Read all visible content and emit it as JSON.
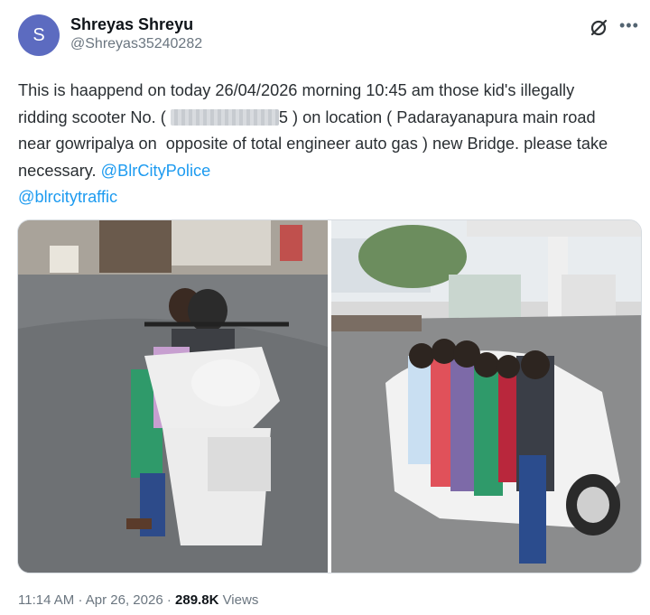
{
  "author": {
    "avatar_letter": "S",
    "display_name": "Shreyas Shreyu",
    "handle": "@Shreyas35240282"
  },
  "icons": {
    "grok": "grok-icon",
    "more": "more-options-icon"
  },
  "tweet": {
    "text_part1": "This is haappend on today 26/04/2026 morning 10:45 am those kid's illegally   ridding scooter No. ( ",
    "redacted_tail": "5",
    "text_part2": " ) on location ( Padarayanapura main road near gowripalya on  opposite of total engineer auto gas ) new Bridge. please take necessary. ",
    "mention1": "@BlrCityPolice",
    "mention2": "@blrcitytraffic"
  },
  "footer": {
    "time": "11:14 AM",
    "date": "Apr 26, 2026",
    "views_count": "289.8K",
    "views_label": "Views"
  },
  "colors": {
    "link": "#1d9bf0",
    "avatar": "#5c6bc0"
  }
}
